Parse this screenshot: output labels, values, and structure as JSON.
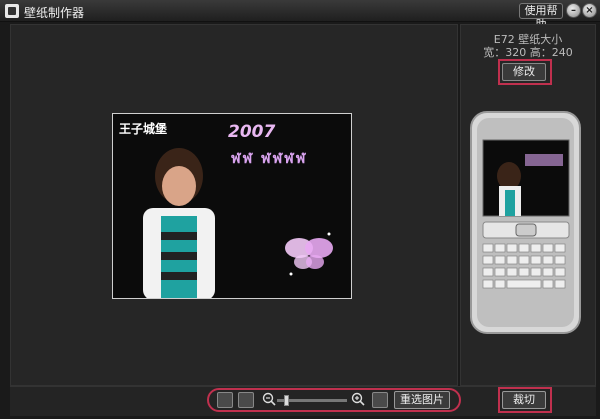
{
  "window": {
    "title": "壁纸制作器",
    "help_label": "使用帮助",
    "minimize_glyph": "–",
    "close_glyph": "×"
  },
  "phone_info": {
    "model_line": "E72  壁纸大小",
    "dims_line": "宽：320   高：240",
    "modify_label": "修改"
  },
  "photo": {
    "logo_text": "王子城堡",
    "year_text": "2007",
    "decor_text": "ฬฬ ฬฬฬฬ"
  },
  "toolbar": {
    "zoom_level": 0.1,
    "reselect_label": "重选图片",
    "crop_label": "裁切"
  },
  "colors": {
    "highlight": "#c0304e",
    "background": "#1a1a1a",
    "panel": "#262626"
  }
}
